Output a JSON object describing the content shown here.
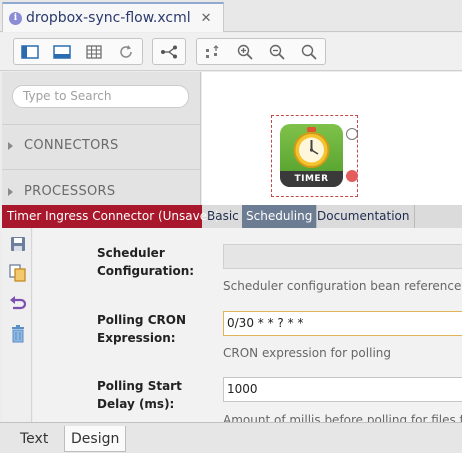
{
  "editor_tab": {
    "title": "dropbox-sync-flow.xcml",
    "close": "✕"
  },
  "toolbar": {
    "icons": [
      "palette-toggle-icon",
      "bottom-panel-icon",
      "grid-icon",
      "refresh-icon",
      "layout-icon",
      "fit-icon",
      "zoom-in-icon",
      "zoom-out-icon",
      "zoom-reset-icon"
    ]
  },
  "palette": {
    "search_placeholder": "Type to Search",
    "sections": [
      {
        "label": "CONNECTORS"
      },
      {
        "label": "PROCESSORS"
      }
    ]
  },
  "canvas": {
    "node": {
      "label": "TIMER",
      "color": "#5fae35"
    }
  },
  "properties": {
    "title": "Timer Ingress Connector (Unsaved)",
    "title_color": "#a8172b",
    "tabs": [
      {
        "label": "Basic",
        "active": false
      },
      {
        "label": "Scheduling",
        "active": true
      },
      {
        "label": "Documentation",
        "active": false
      }
    ],
    "fields": {
      "scheduler_label_line1": "Scheduler",
      "scheduler_label_line2": "Configuration:",
      "scheduler_value": "",
      "scheduler_help": "Scheduler configuration bean reference",
      "cron_label_line1": "Polling CRON",
      "cron_label_line2": "Expression:",
      "cron_value": "0/30 * * ? * *",
      "cron_help": "CRON expression for polling",
      "delay_label_line1": "Polling Start",
      "delay_label_line2": "Delay (ms):",
      "delay_value": "1000",
      "delay_help": "Amount of millis before polling for files fo"
    }
  },
  "bottom_tabs": [
    {
      "label": "Text",
      "active": false
    },
    {
      "label": "Design",
      "active": true
    }
  ]
}
